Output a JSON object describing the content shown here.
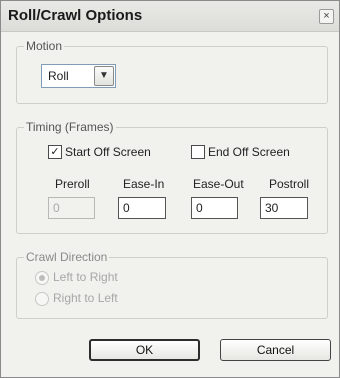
{
  "window": {
    "title": "Roll/Crawl Options",
    "close_glyph": "×"
  },
  "motion": {
    "legend": "Motion",
    "selected": "Roll",
    "dropdown_glyph": "▼"
  },
  "timing": {
    "legend": "Timing (Frames)",
    "start_off_screen": {
      "label": "Start Off Screen",
      "checked": true,
      "glyph": "✓"
    },
    "end_off_screen": {
      "label": "End Off Screen",
      "checked": false
    },
    "preroll": {
      "label": "Preroll",
      "value": "0",
      "disabled": true
    },
    "ease_in": {
      "label": "Ease-In",
      "value": "0"
    },
    "ease_out": {
      "label": "Ease-Out",
      "value": "0"
    },
    "postroll": {
      "label": "Postroll",
      "value": "30"
    }
  },
  "crawl": {
    "legend": "Crawl Direction",
    "disabled": true,
    "options": [
      {
        "label": "Left to Right",
        "selected": true
      },
      {
        "label": "Right to Left",
        "selected": false
      }
    ]
  },
  "buttons": {
    "ok": "OK",
    "cancel": "Cancel"
  }
}
